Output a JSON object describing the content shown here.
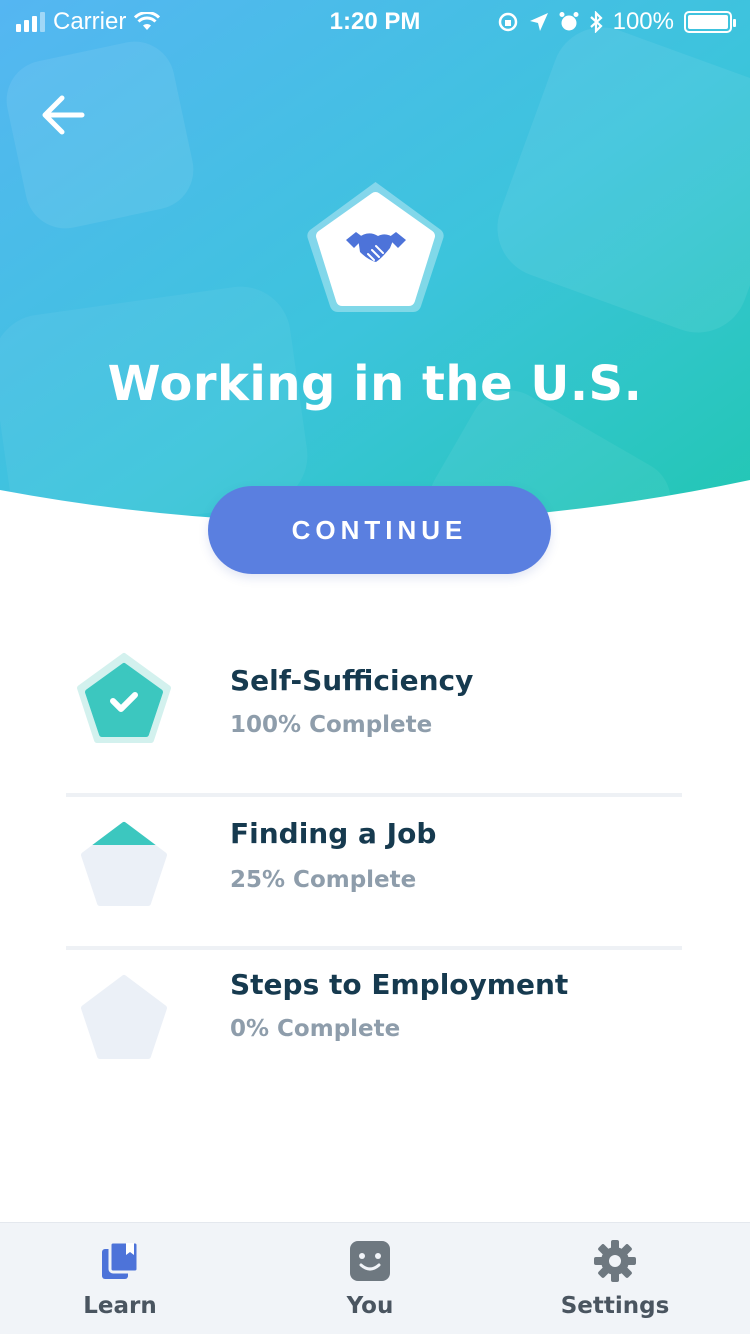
{
  "status_bar": {
    "carrier": "Carrier",
    "time": "1:20 PM",
    "battery": "100%"
  },
  "header": {
    "title": "Working in the U.S.",
    "back_icon": "arrow-left-icon",
    "badge_icon": "handshake-icon",
    "gradient": [
      "#4fb8f0",
      "#2ec9bd"
    ]
  },
  "continue_label": "CONTINUE",
  "lessons": [
    {
      "name": "Self-Sufficiency",
      "progress_text": "100% Complete",
      "progress": 1.0,
      "icon": "check-icon"
    },
    {
      "name": "Finding a Job",
      "progress_text": "25% Complete",
      "progress": 0.25
    },
    {
      "name": "Steps to Employment",
      "progress_text": "0% Complete",
      "progress": 0.0
    }
  ],
  "tabs": [
    {
      "label": "Learn",
      "icon": "book-icon",
      "active": true
    },
    {
      "label": "You",
      "icon": "smiley-icon",
      "active": false
    },
    {
      "label": "Settings",
      "icon": "gear-icon",
      "active": false
    }
  ],
  "colors": {
    "accent": "#5a7fe0",
    "teal": "#3cc7bf",
    "text_dark": "#163a4f",
    "text_muted": "#8e9dab"
  }
}
